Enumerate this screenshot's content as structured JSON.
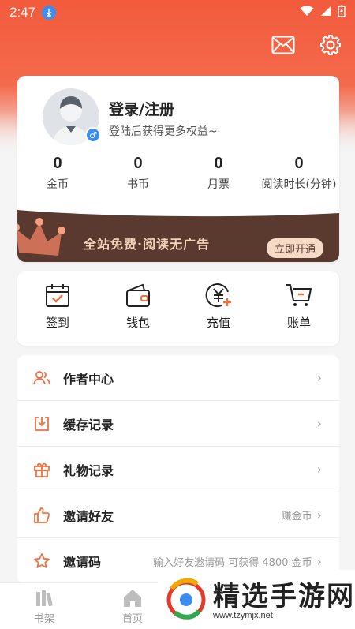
{
  "status_bar": {
    "time": "2:47"
  },
  "profile": {
    "login_title": "登录/注册",
    "login_subtitle": "登陆后获得更多权益~",
    "stats": [
      {
        "value": "0",
        "label": "金币"
      },
      {
        "value": "0",
        "label": "书币"
      },
      {
        "value": "0",
        "label": "月票"
      },
      {
        "value": "0",
        "label": "阅读时长(分钟)"
      }
    ]
  },
  "vip": {
    "text": "全站免费·阅读无广告",
    "button": "立即开通"
  },
  "quick_actions": [
    {
      "label": "签到",
      "icon": "calendar-check-icon"
    },
    {
      "label": "钱包",
      "icon": "wallet-icon"
    },
    {
      "label": "充值",
      "icon": "yuan-plus-icon"
    },
    {
      "label": "账单",
      "icon": "cart-icon"
    }
  ],
  "menu": [
    {
      "label": "作者中心",
      "hint": "",
      "icon": "people-icon"
    },
    {
      "label": "缓存记录",
      "hint": "",
      "icon": "download-icon"
    },
    {
      "label": "礼物记录",
      "hint": "",
      "icon": "gift-icon"
    },
    {
      "label": "邀请好友",
      "hint": "赚金币",
      "icon": "thumbs-up-icon"
    },
    {
      "label": "邀请码",
      "hint": "输入好友邀请码 可获得 4800 金币",
      "icon": "star-icon"
    }
  ],
  "bottom_nav": [
    {
      "label": "书架",
      "icon": "bookshelf-icon"
    },
    {
      "label": "首页",
      "icon": "home-icon"
    }
  ],
  "watermark": {
    "text": "精选手游网",
    "url": "www.tzymjx.net"
  },
  "colors": {
    "accent": "#f25b3c",
    "icon_orange": "#f0703f",
    "vip_bg": "#5a3a2f"
  }
}
